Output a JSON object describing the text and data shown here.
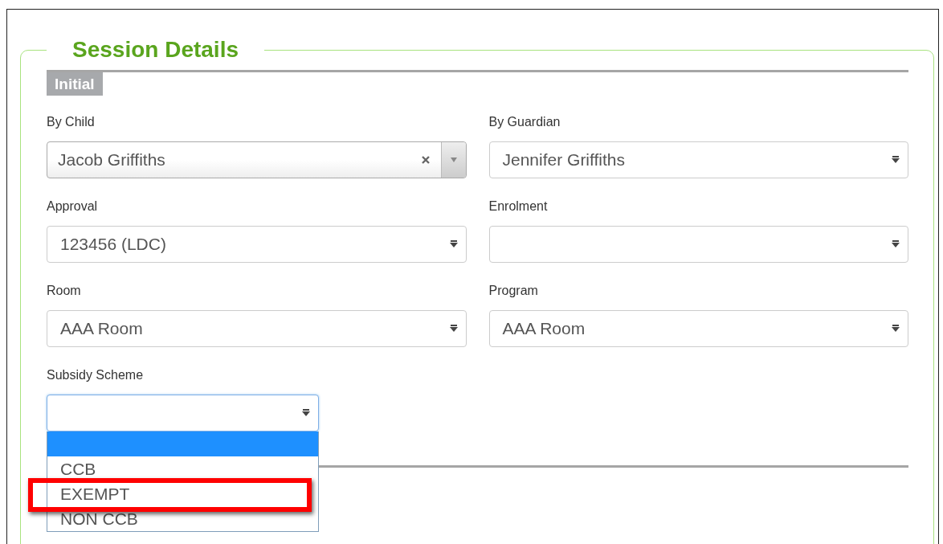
{
  "section": {
    "title": "Session Details"
  },
  "group": {
    "title": "Initial"
  },
  "fields": [
    {
      "label": "By Child",
      "kind": "combobox",
      "value": "Jacob Griffiths",
      "clearable": true
    },
    {
      "label": "By Guardian",
      "kind": "select",
      "value": "Jennifer Griffiths"
    },
    {
      "label": "Approval",
      "kind": "select",
      "value": "123456 (LDC)"
    },
    {
      "label": "Enrolment",
      "kind": "select"
    },
    {
      "label": "Room",
      "kind": "select",
      "value": "AAA Room"
    },
    {
      "label": "Program",
      "kind": "select",
      "value": "AAA Room"
    },
    {
      "label": "Subsidy Scheme",
      "kind": "dropdown",
      "focused": true,
      "open": true,
      "options": [
        {
          "selected": true,
          "highlighted": false
        },
        {
          "label": "CCB",
          "selected": false,
          "highlighted": false
        },
        {
          "label": "EXEMPT",
          "selected": false,
          "highlighted": true
        },
        {
          "label": "NON CCB",
          "selected": false,
          "highlighted": false
        }
      ]
    }
  ]
}
